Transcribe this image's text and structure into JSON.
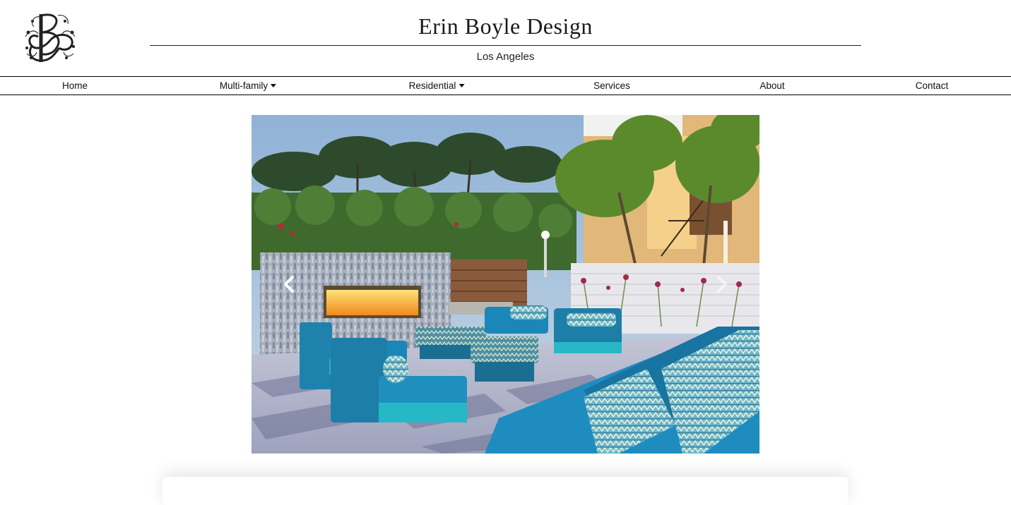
{
  "brand": {
    "title": "Erin Boyle Design",
    "subtitle": "Los Angeles",
    "logo_icon": "monogram-eb-icon"
  },
  "nav": {
    "items": [
      {
        "label": "Home",
        "dropdown": false
      },
      {
        "label": "Multi-family",
        "dropdown": true
      },
      {
        "label": "Residential",
        "dropdown": true
      },
      {
        "label": "Services",
        "dropdown": false
      },
      {
        "label": "About",
        "dropdown": false
      },
      {
        "label": "Contact",
        "dropdown": false
      }
    ]
  },
  "carousel": {
    "prev_icon": "chevron-left-icon",
    "next_icon": "chevron-right-icon"
  },
  "colors": {
    "accent_teal": "#1b86b8",
    "nav_border": "#000000"
  }
}
